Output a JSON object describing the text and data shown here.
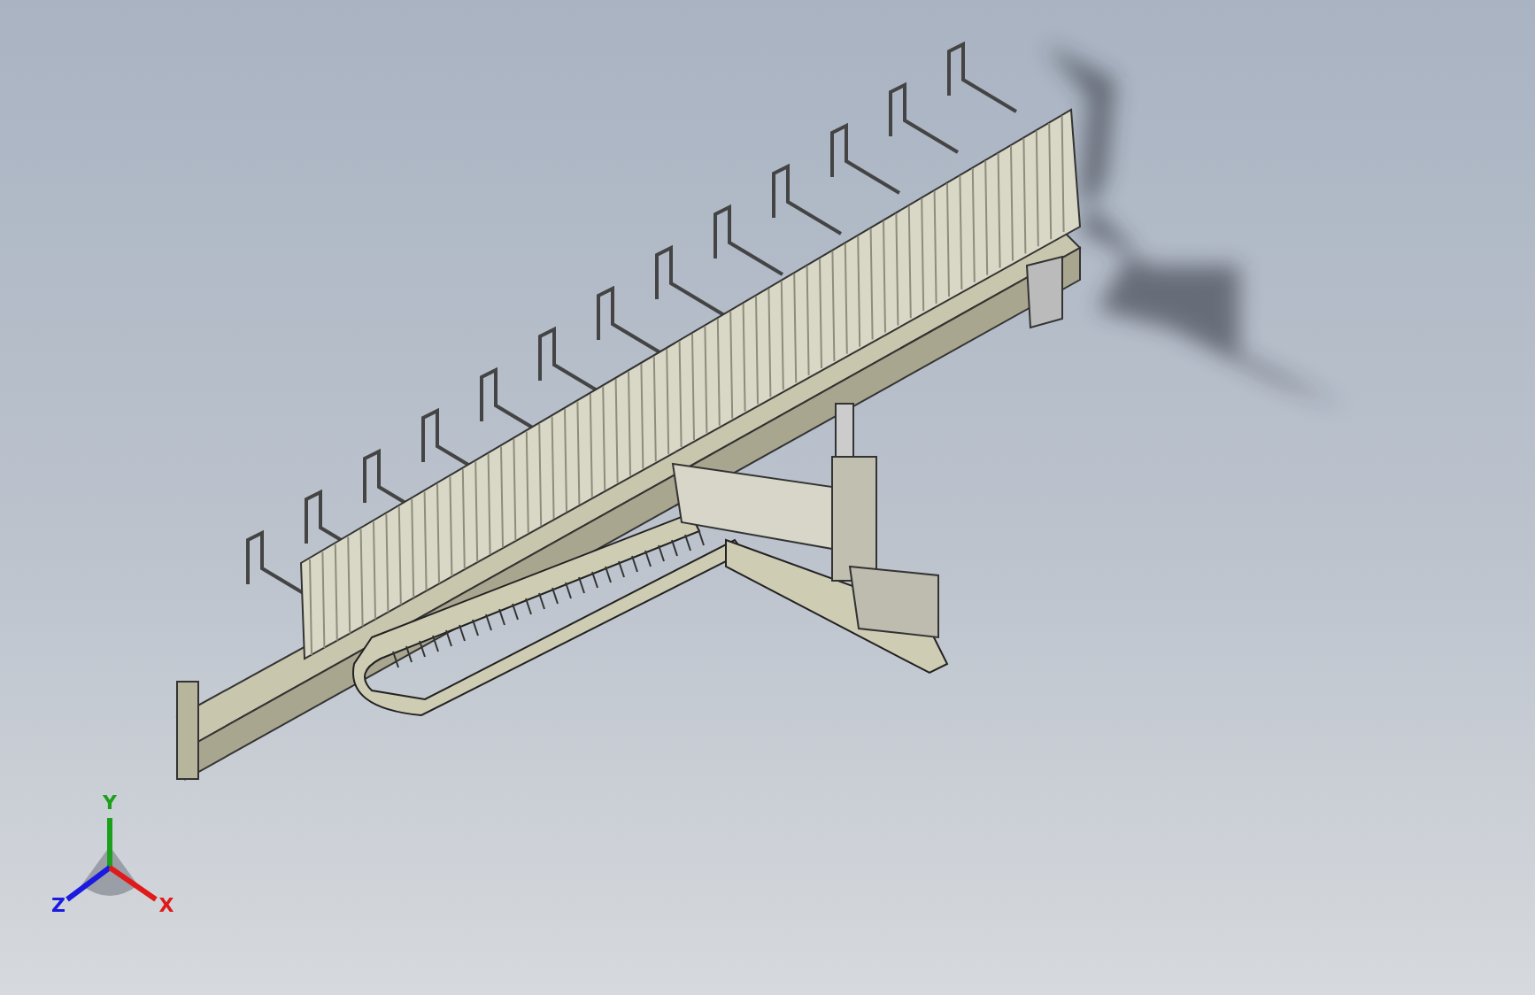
{
  "axis_triad": {
    "axes": [
      {
        "kind": "y",
        "label": "Y",
        "color": "#1aa01a"
      },
      {
        "kind": "z",
        "label": "Z",
        "color": "#1a1ae0"
      },
      {
        "kind": "x",
        "label": "X",
        "color": "#e01a1a"
      }
    ]
  }
}
